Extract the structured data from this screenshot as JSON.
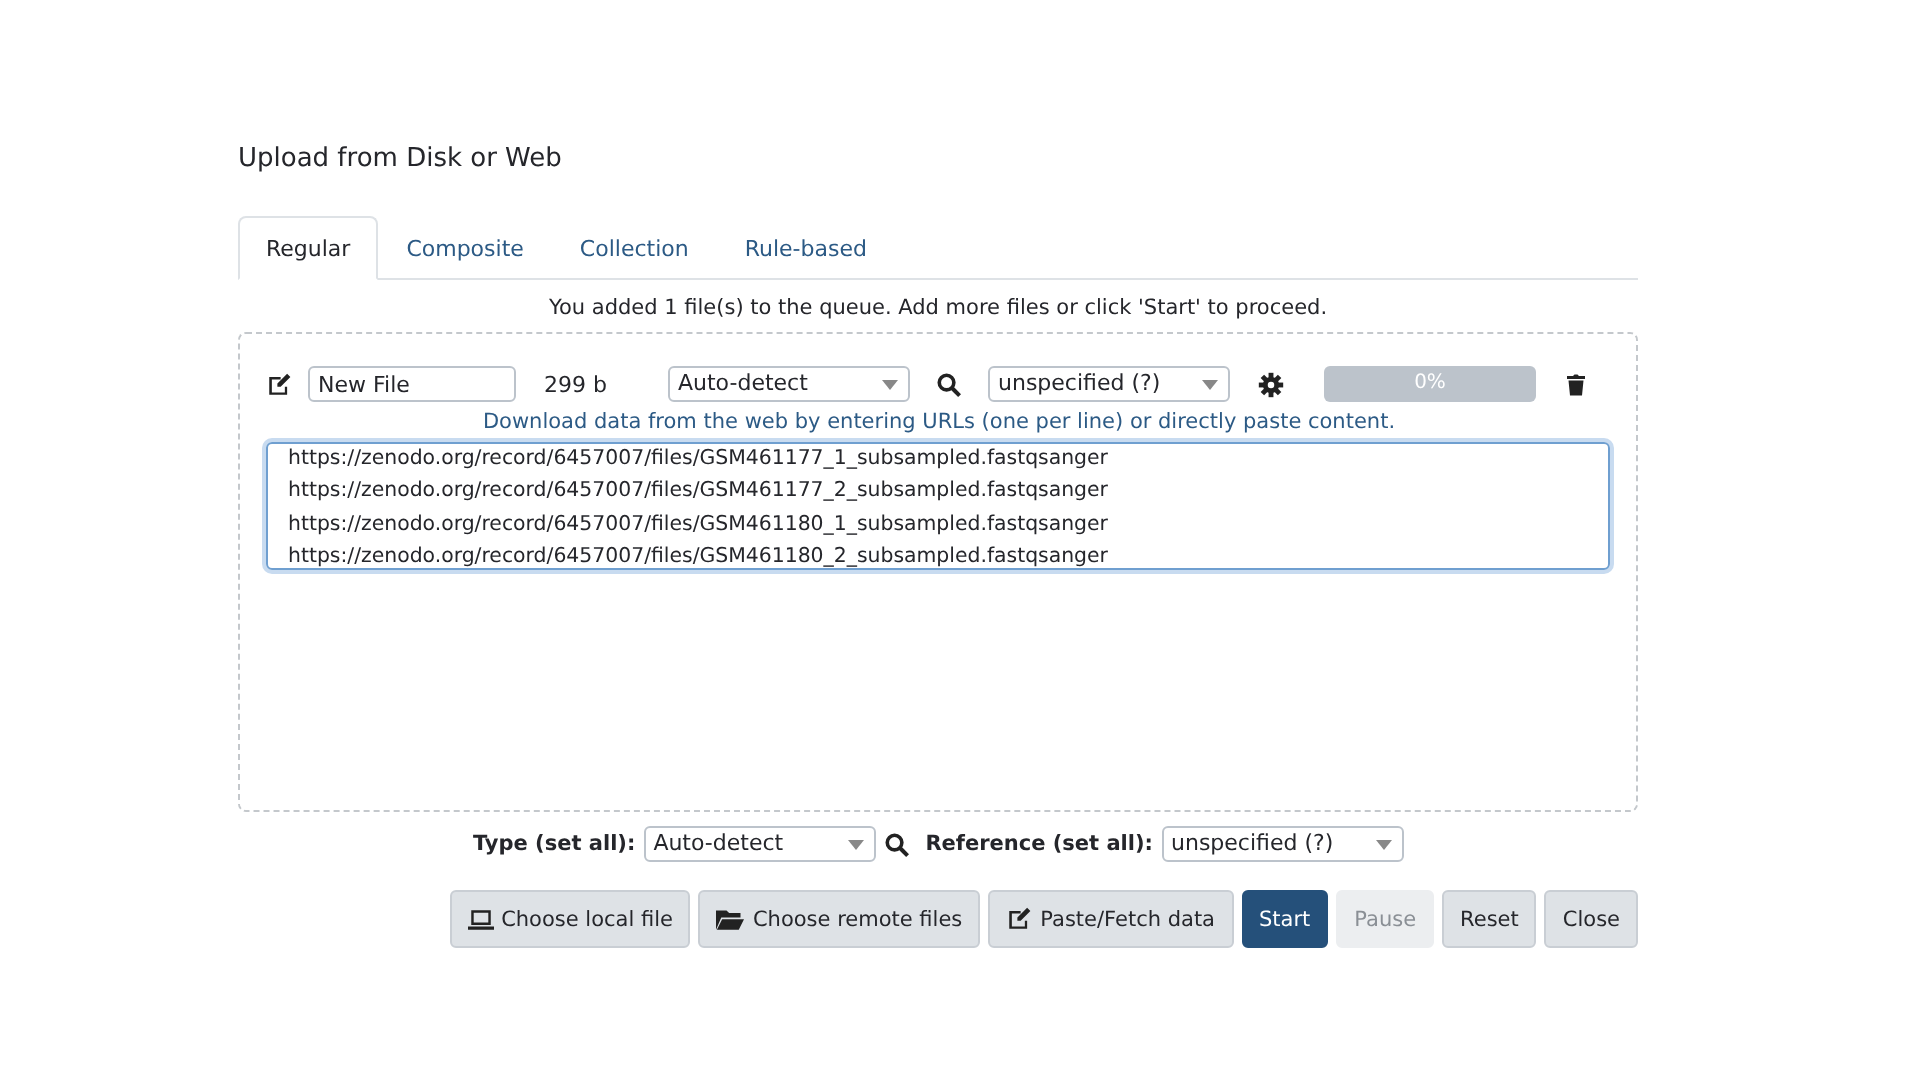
{
  "dialog": {
    "title": "Upload from Disk or Web"
  },
  "tabs": [
    {
      "label": "Regular",
      "selected": true
    },
    {
      "label": "Composite",
      "selected": false
    },
    {
      "label": "Collection",
      "selected": false
    },
    {
      "label": "Rule-based",
      "selected": false
    }
  ],
  "queue_message": "You added 1 file(s) to the queue. Add more files or click 'Start' to proceed.",
  "file_row": {
    "name": "New File",
    "size": "299 b",
    "type": "Auto-detect",
    "reference": "unspecified (?)",
    "progress": {
      "level": 0,
      "reading": "0%"
    },
    "hint": "Download data from the web by entering URLs (one per line) or directly paste content.",
    "content": [
      "https://zenodo.org/record/6457007/files/GSM461177_1_subsampled.fastqsanger",
      "https://zenodo.org/record/6457007/files/GSM461177_2_subsampled.fastqsanger",
      "https://zenodo.org/record/6457007/files/GSM461180_1_subsampled.fastqsanger",
      "https://zenodo.org/record/6457007/files/GSM461180_2_subsampled.fastqsanger"
    ]
  },
  "set_all": {
    "type_label": "Type (set all):",
    "type_value": "Auto-detect",
    "reference_label": "Reference (set all):",
    "reference_value": "unspecified (?)"
  },
  "buttons": [
    {
      "label": "Choose local file",
      "kind": "default"
    },
    {
      "label": "Choose remote files",
      "kind": "default"
    },
    {
      "label": "Paste/Fetch data",
      "kind": "default"
    },
    {
      "label": "Start",
      "kind": "primary"
    },
    {
      "label": "Pause",
      "kind": "disabled"
    },
    {
      "label": "Reset",
      "kind": "default"
    },
    {
      "label": "Close",
      "kind": "default"
    }
  ]
}
